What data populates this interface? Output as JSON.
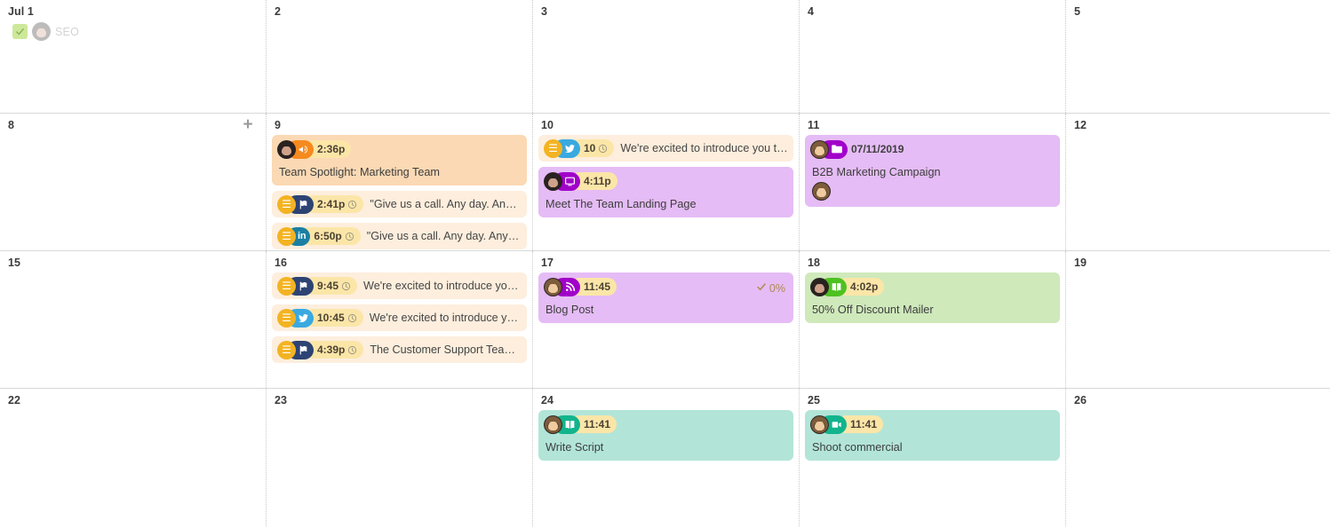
{
  "calendar": {
    "add_button_label": "+",
    "weeks": [
      {
        "days": [
          {
            "label": "Jul 1",
            "ghost": {
              "label": "SEO",
              "icon": "check-icon"
            },
            "events": []
          },
          {
            "label": "2",
            "events": []
          },
          {
            "label": "3",
            "events": []
          },
          {
            "label": "4",
            "events": []
          },
          {
            "label": "5",
            "events": []
          }
        ]
      },
      {
        "days": [
          {
            "label": "8",
            "show_add": true,
            "events": []
          },
          {
            "label": "9",
            "events": [
              {
                "kind": "card",
                "bg": "#fbd9b4",
                "avatar": "dark",
                "channel_icon": "megaphone-icon",
                "channel_color": "#f58a1f",
                "time": "2:36p",
                "title": "Team Spotlight: Marketing Team"
              },
              {
                "kind": "compact",
                "bg": "#fdeedd",
                "avatar": "gold",
                "channel_icon": "facebook-flag-icon",
                "channel_color": "#2d4373",
                "time": "2:41p",
                "clock": true,
                "preview": "\"Give us a call. Any day. Any …"
              },
              {
                "kind": "compact",
                "bg": "#fdeedd",
                "avatar": "gold",
                "channel_icon": "linkedin-icon",
                "channel_color": "#1a7fa3",
                "time": "6:50p",
                "clock": true,
                "preview": "\"Give us a call. Any day. Any …"
              }
            ]
          },
          {
            "label": "10",
            "events": [
              {
                "kind": "compact",
                "bg": "#fdeedd",
                "avatar": "gold",
                "channel_icon": "twitter-icon",
                "channel_color": "#3aa9e0",
                "time": "10",
                "clock": true,
                "preview": "We're excited to introduce you t…"
              },
              {
                "kind": "card",
                "bg": "#e5bcf5",
                "avatar": "dark",
                "channel_icon": "monitor-icon",
                "channel_color": "#a100c9",
                "time": "4:11p",
                "title": "Meet The Team Landing Page"
              }
            ]
          },
          {
            "label": "11",
            "events": [
              {
                "kind": "card",
                "bg": "#e5bcf5",
                "avatar": "blonde",
                "channel_icon": "folder-icon",
                "channel_color": "#a100c9",
                "time": "07/11/2019",
                "time_plain": true,
                "title": "B2B Marketing Campaign",
                "sub_avatar": "blonde",
                "tall": true
              }
            ]
          },
          {
            "label": "12",
            "events": []
          }
        ]
      },
      {
        "days": [
          {
            "label": "15",
            "events": []
          },
          {
            "label": "16",
            "events": [
              {
                "kind": "compact",
                "bg": "#fdeedd",
                "avatar": "gold",
                "channel_icon": "facebook-flag-icon",
                "channel_color": "#2d4373",
                "time": "9:45",
                "clock": true,
                "preview": "We're excited to introduce you…"
              },
              {
                "kind": "compact",
                "bg": "#fdeedd",
                "avatar": "gold",
                "channel_icon": "twitter-icon",
                "channel_color": "#3aa9e0",
                "time": "10:45",
                "clock": true,
                "preview": "We're excited to introduce yo…"
              },
              {
                "kind": "compact",
                "bg": "#fdeedd",
                "avatar": "gold",
                "channel_icon": "facebook-flag-icon",
                "channel_color": "#2d4373",
                "time": "4:39p",
                "clock": true,
                "preview": "The Customer Support Team…"
              }
            ]
          },
          {
            "label": "17",
            "events": [
              {
                "kind": "card",
                "bg": "#e5bcf5",
                "avatar": "blonde",
                "channel_icon": "rss-icon",
                "channel_color": "#a100c9",
                "time": "11:45",
                "title": "Blog Post",
                "approval": "0%"
              }
            ]
          },
          {
            "label": "18",
            "events": [
              {
                "kind": "card",
                "bg": "#cfe9bb",
                "avatar": "dark",
                "channel_icon": "book-icon",
                "channel_color": "#4ec121",
                "time": "4:02p",
                "title": "50% Off Discount Mailer"
              }
            ]
          },
          {
            "label": "19",
            "events": []
          }
        ]
      },
      {
        "days": [
          {
            "label": "22",
            "events": []
          },
          {
            "label": "23",
            "events": []
          },
          {
            "label": "24",
            "events": [
              {
                "kind": "card",
                "bg": "#b2e5d8",
                "avatar": "blonde",
                "channel_icon": "book-icon",
                "channel_color": "#12b48c",
                "time": "11:41",
                "title": "Write Script"
              }
            ]
          },
          {
            "label": "25",
            "events": [
              {
                "kind": "card",
                "bg": "#b2e5d8",
                "avatar": "blonde",
                "channel_icon": "video-camera-icon",
                "channel_color": "#12b48c",
                "time": "11:41",
                "title": "Shoot commercial"
              }
            ]
          },
          {
            "label": "26",
            "events": []
          }
        ]
      }
    ]
  }
}
